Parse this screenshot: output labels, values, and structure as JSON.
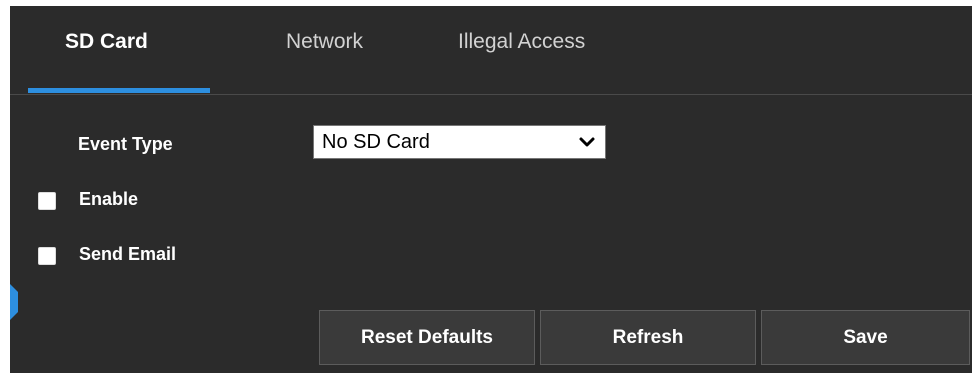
{
  "tabs": [
    {
      "label": "SD Card",
      "active": true
    },
    {
      "label": "Network",
      "active": false
    },
    {
      "label": "Illegal Access",
      "active": false
    }
  ],
  "form": {
    "event_type_label": "Event Type",
    "event_type_value": "No SD Card",
    "enable_label": "Enable",
    "enable_checked": false,
    "send_email_label": "Send Email",
    "send_email_checked": false
  },
  "buttons": {
    "reset_label": "Reset Defaults",
    "refresh_label": "Refresh",
    "save_label": "Save"
  },
  "colors": {
    "background": "#2b2b2b",
    "accent": "#2d8fe0",
    "button_bg": "#3a3a3a"
  },
  "icons": {
    "dropdown": "chevron-down-icon",
    "side_handle": "side-expand-handle-icon"
  }
}
